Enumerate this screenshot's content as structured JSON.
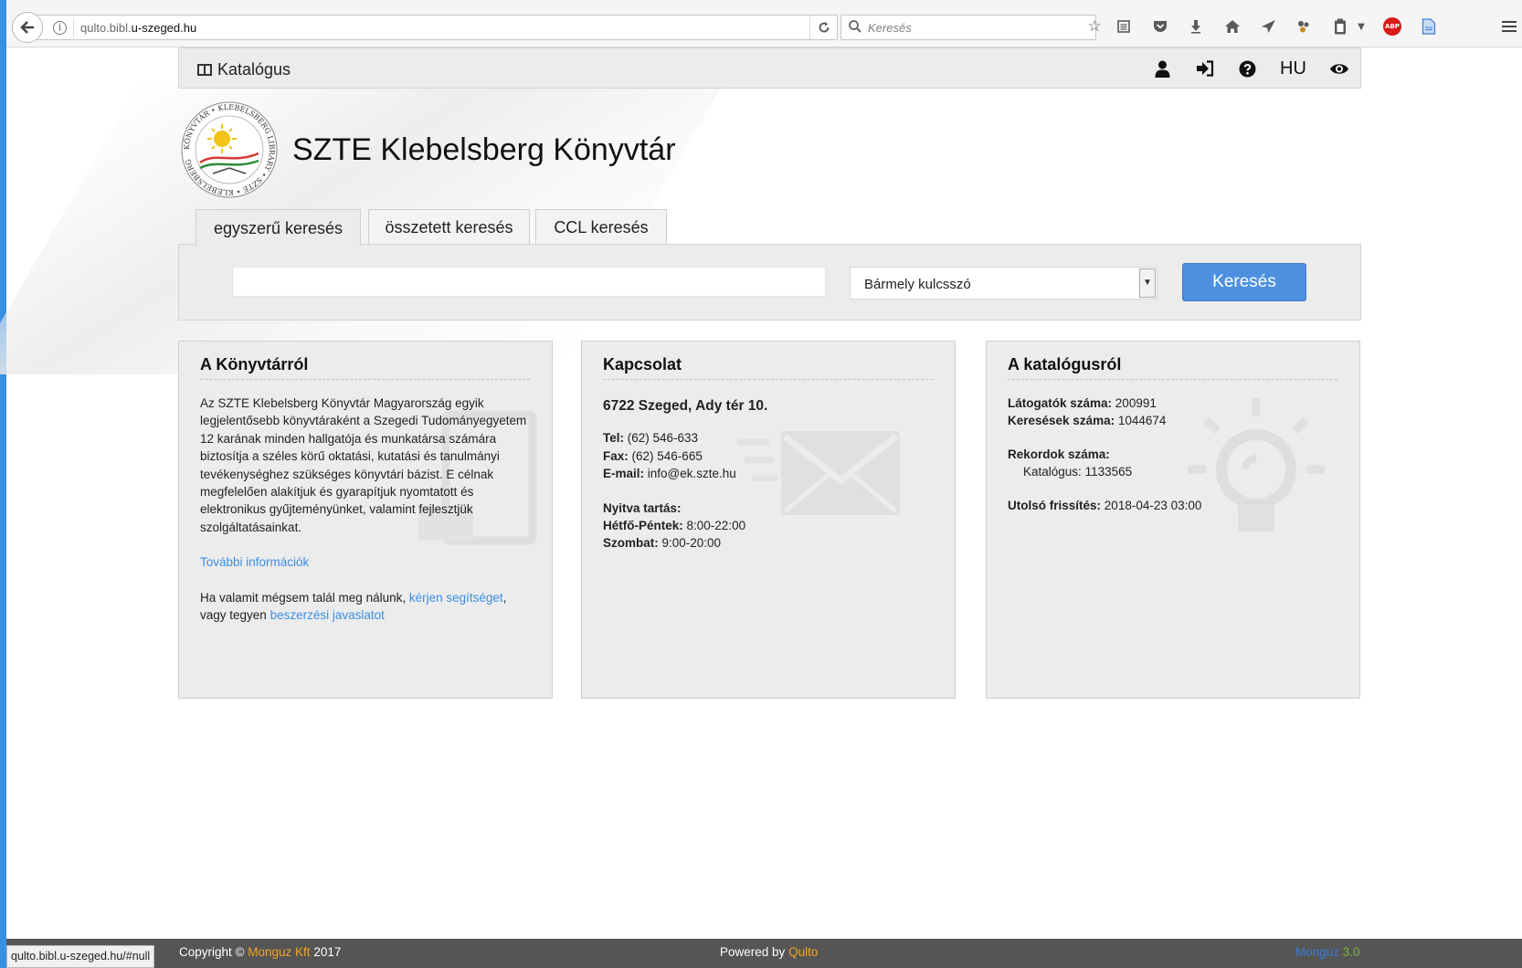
{
  "browser": {
    "url_prefix": "qulto.bibl.",
    "url_domain": "u-szeged.hu",
    "search_placeholder": "Keresés"
  },
  "topbar": {
    "catalog_label": "Katalógus",
    "language": "HU"
  },
  "header": {
    "logo_ring_text": "KÖNYVTÁR • KLEBELSBERG LIBRARY • SZTE • KLEBELSBERG",
    "title": "SZTE Klebelsberg Könyvtár"
  },
  "tabs": [
    {
      "label": "egyszerű keresés",
      "active": true
    },
    {
      "label": "összetett keresés",
      "active": false
    },
    {
      "label": "CCL keresés",
      "active": false
    }
  ],
  "search": {
    "query": "",
    "field_selected": "Bármely kulcsszó",
    "button_label": "Keresés"
  },
  "about": {
    "title": "A Könyvtárról",
    "text": "Az SZTE Klebelsberg Könyvtár Magyarország egyik legjelentősebb könyvtáraként a Szegedi Tudományegyetem 12 karának minden hallgatója és munkatársa számára biztosítja a széles körű oktatási, kutatási és tanulmányi tevékenységhez szükséges könyvtári bázist. E célnak megfelelően alakítjuk és gyarapítjuk nyomtatott és elektronikus gyűjteményünket, valamint fejlesztjük szolgáltatásainkat.",
    "more_link": "További információk",
    "help_prefix": "Ha valamit mégsem talál meg nálunk, ",
    "help_link": "kérjen segítséget",
    "help_mid": ",",
    "help_mid2": "vagy tegyen ",
    "suggest_link": "beszerzési javaslatot"
  },
  "contact": {
    "title": "Kapcsolat",
    "address": "6722 Szeged, Ady tér 10.",
    "tel_label": "Tel:",
    "tel": "(62) 546-633",
    "fax_label": "Fax:",
    "fax": "(62) 546-665",
    "email_label": "E-mail:",
    "email": "info@ek.szte.hu",
    "hours_title": "Nyitva tartás:",
    "weekday_label": "Hétfő-Péntek:",
    "weekday_hours": "8:00-22:00",
    "saturday_label": "Szombat:",
    "saturday_hours": "9:00-20:00"
  },
  "catalog": {
    "title": "A katalógusról",
    "visitors_label": "Látogatók száma:",
    "visitors": "200991",
    "searches_label": "Keresések száma:",
    "searches": "1044674",
    "records_label": "Rekordok száma:",
    "catalog_records_label": "Katalógus:",
    "catalog_records": "1133565",
    "updated_label": "Utolsó frissítés:",
    "updated": "2018-04-23 03:00"
  },
  "footer": {
    "status_url": "qulto.bibl.u-szeged.hu/#null",
    "copyright_prefix": "Copyright ©",
    "company": "Monguz Kft",
    "year": "2017",
    "powered_prefix": "Powered by",
    "powered_brand": "Qulto",
    "version_brand": "Monguz",
    "version": "3.0"
  },
  "colors": {
    "accent": "#4d90e0",
    "link": "#3d8ee3",
    "footer_bg": "#555555",
    "footer_orange": "#f0a422"
  }
}
